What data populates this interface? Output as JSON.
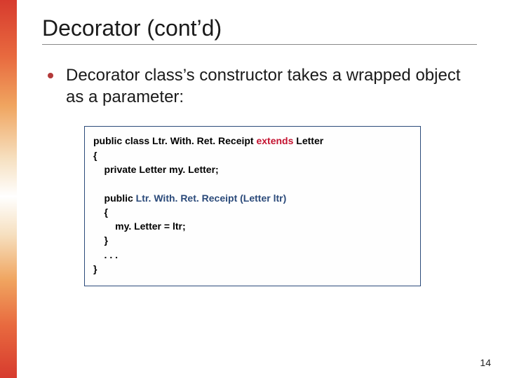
{
  "title": "Decorator (cont’d)",
  "bullet": "Decorator class’s constructor takes a wrapped object as a parameter:",
  "code": {
    "l1a": "public class Ltr. With. Ret. Receipt ",
    "l1b": "extends",
    "l1c": " Letter",
    "l2": "{",
    "l3": "    private Letter my. Letter;",
    "blank": " ",
    "l4a": "    public ",
    "l4b": "Ltr. With. Ret. Receipt (Letter ltr)",
    "l5": "    {",
    "l6": "        my. Letter = ltr;",
    "l7": "    }",
    "l8": "    . . .",
    "l9": "}"
  },
  "page": "14"
}
